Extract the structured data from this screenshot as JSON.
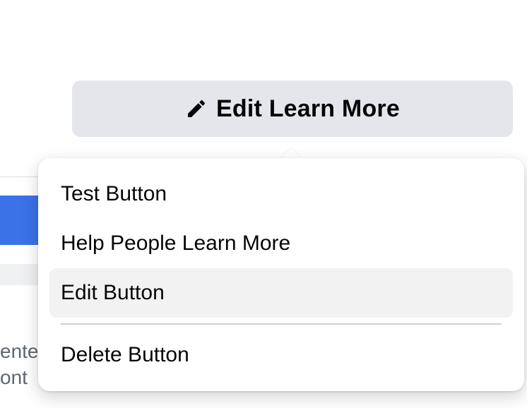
{
  "background": {
    "text_line_1": "ente",
    "text_line_2": "ont"
  },
  "edit_button": {
    "icon": "pencil-icon",
    "label": "Edit Learn More"
  },
  "menu": {
    "items": [
      {
        "label": "Test Button"
      },
      {
        "label": "Help People Learn More"
      },
      {
        "label": "Edit Button",
        "highlighted": true
      },
      {
        "label": "Delete Button"
      }
    ]
  },
  "colors": {
    "button_bg": "#e4e6eb",
    "highlight_bg": "#f2f2f2",
    "blue_accent": "#3b72e8",
    "text": "#050505"
  }
}
